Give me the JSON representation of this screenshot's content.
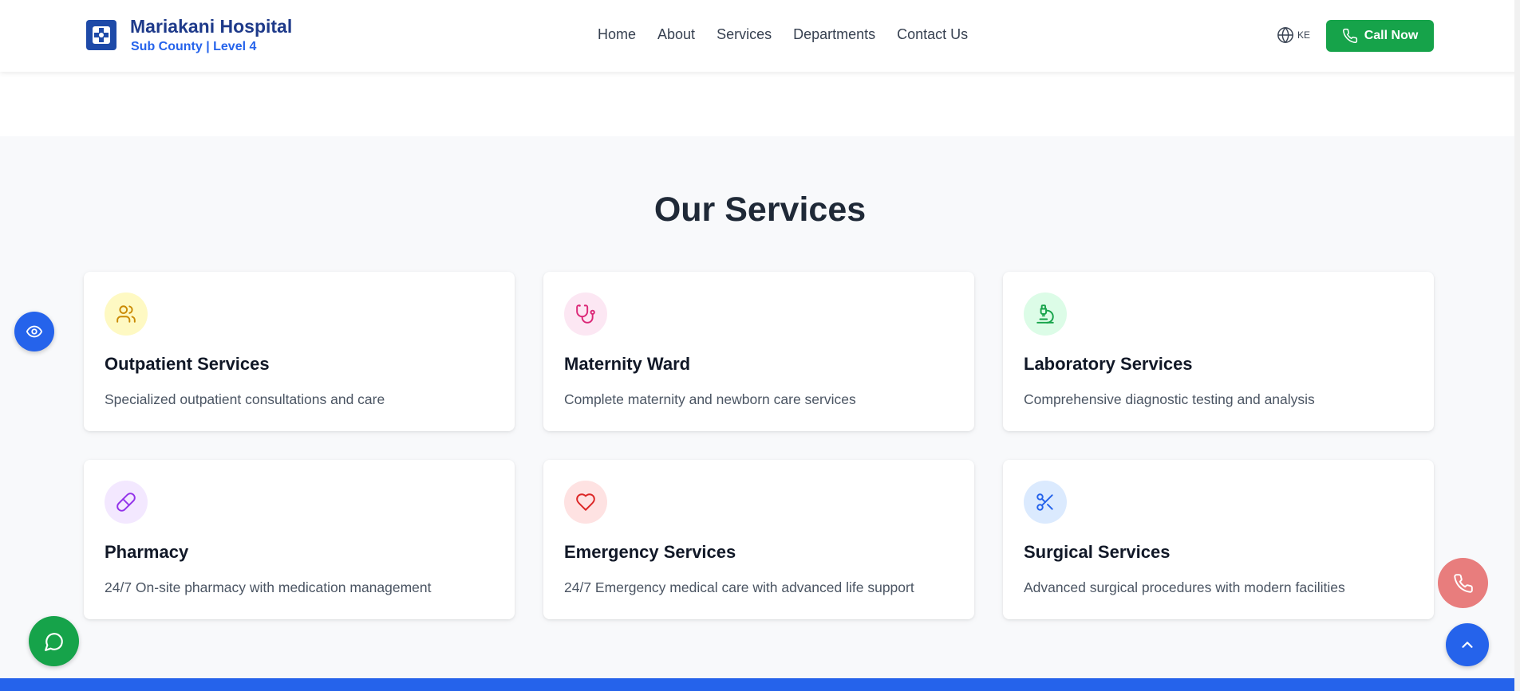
{
  "header": {
    "brand_name": "Mariakani Hospital",
    "brand_sub": "Sub County | Level 4",
    "nav": [
      "Home",
      "About",
      "Services",
      "Departments",
      "Contact Us"
    ],
    "lang": "KE",
    "call_label": "Call Now"
  },
  "services": {
    "title": "Our Services",
    "items": [
      {
        "title": "Outpatient Services",
        "desc": "Specialized outpatient consultations and care",
        "icon": "users-icon",
        "bg": "#fef9c3",
        "color": "#ca8a04"
      },
      {
        "title": "Maternity Ward",
        "desc": "Complete maternity and newborn care services",
        "icon": "stethoscope-icon",
        "bg": "#fce7f3",
        "color": "#db2777"
      },
      {
        "title": "Laboratory Services",
        "desc": "Comprehensive diagnostic testing and analysis",
        "icon": "microscope-icon",
        "bg": "#dcfce7",
        "color": "#16a34a"
      },
      {
        "title": "Pharmacy",
        "desc": "24/7 On-site pharmacy with medication management",
        "icon": "pill-icon",
        "bg": "#f3e8ff",
        "color": "#9333ea"
      },
      {
        "title": "Emergency Services",
        "desc": "24/7 Emergency medical care with advanced life support",
        "icon": "heart-icon",
        "bg": "#fee2e2",
        "color": "#dc2626"
      },
      {
        "title": "Surgical Services",
        "desc": "Advanced surgical procedures with modern facilities",
        "icon": "scissors-icon",
        "bg": "#dbeafe",
        "color": "#2563eb"
      }
    ]
  },
  "colors": {
    "primary": "#2563eb",
    "green": "#16a34a",
    "brand_dark": "#1e3a8a",
    "phone_fab": "#e87d7d"
  }
}
